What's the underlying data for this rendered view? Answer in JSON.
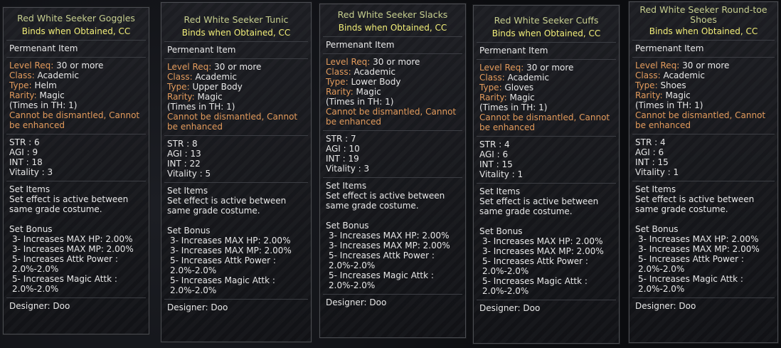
{
  "tooltips": [
    {
      "title": "Red White Seeker Goggles",
      "bind": "Binds when Obtained, CC",
      "item_type": "Permenant Item",
      "level_key": "Level Req:",
      "level_val": "30 or more",
      "class_key": "Class:",
      "class_val": "Academic",
      "type_key": "Type:",
      "type_val": "Helm",
      "rarity_key": "Rarity:",
      "rarity_val": "Magic",
      "times": "(Times in TH: 1)",
      "warning": "Cannot be dismantled, Cannot be enhanced",
      "stats": [
        "STR : 6",
        "AGI : 9",
        "INT : 18",
        "Vitality : 3"
      ],
      "set_items_label": "Set Items",
      "set_effect": "Set effect is active between same grade costume.",
      "set_bonus_label": "Set Bonus",
      "bonuses": [
        "3- Increases MAX HP: 2.00%",
        "3- Increases MAX MP: 2.00%",
        "5- Increases Attk Power : 2.0%-2.0%",
        "5- Increases Magic Attk : 2.0%-2.0%"
      ],
      "designer": "Designer: Doo"
    },
    {
      "title": "Red White Seeker Tunic",
      "bind": "Binds when Obtained, CC",
      "item_type": "Permenant Item",
      "level_key": "Level Req:",
      "level_val": "30 or more",
      "class_key": "Class:",
      "class_val": "Academic",
      "type_key": "Type:",
      "type_val": "Upper Body",
      "rarity_key": "Rarity:",
      "rarity_val": "Magic",
      "times": "(Times in TH: 1)",
      "warning": "Cannot be dismantled, Cannot be enhanced",
      "stats": [
        "STR : 8",
        "AGI : 13",
        "INT : 22",
        "Vitality : 5"
      ],
      "set_items_label": "Set Items",
      "set_effect": "Set effect is active between same grade costume.",
      "set_bonus_label": "Set Bonus",
      "bonuses": [
        "3- Increases MAX HP: 2.00%",
        "3- Increases MAX MP: 2.00%",
        "5- Increases Attk Power : 2.0%-2.0%",
        "5- Increases Magic Attk : 2.0%-2.0%"
      ],
      "designer": "Designer: Doo"
    },
    {
      "title": "Red White Seeker Slacks",
      "bind": "Binds when Obtained, CC",
      "item_type": "Permenant Item",
      "level_key": "Level Req:",
      "level_val": "30 or more",
      "class_key": "Class:",
      "class_val": "Academic",
      "type_key": "Type:",
      "type_val": "Lower Body",
      "rarity_key": "Rarity:",
      "rarity_val": "Magic",
      "times": "(Times in TH: 1)",
      "warning": "Cannot be dismantled, Cannot be enhanced",
      "stats": [
        "STR : 7",
        "AGI : 10",
        "INT : 19",
        "Vitality : 3"
      ],
      "set_items_label": "Set Items",
      "set_effect": "Set effect is active between same grade costume.",
      "set_bonus_label": "Set Bonus",
      "bonuses": [
        "3- Increases MAX HP: 2.00%",
        "3- Increases MAX MP: 2.00%",
        "5- Increases Attk Power : 2.0%-2.0%",
        "5- Increases Magic Attk : 2.0%-2.0%"
      ],
      "designer": "Designer: Doo"
    },
    {
      "title": "Red White Seeker Cuffs",
      "bind": "Binds when Obtained, CC",
      "item_type": "Permenant Item",
      "level_key": "Level Req:",
      "level_val": "30 or more",
      "class_key": "Class:",
      "class_val": "Academic",
      "type_key": "Type:",
      "type_val": "Gloves",
      "rarity_key": "Rarity:",
      "rarity_val": "Magic",
      "times": "(Times in TH: 1)",
      "warning": "Cannot be dismantled, Cannot be enhanced",
      "stats": [
        "STR : 4",
        "AGI : 6",
        "INT : 15",
        "Vitality : 1"
      ],
      "set_items_label": "Set Items",
      "set_effect": "Set effect is active between same grade costume.",
      "set_bonus_label": "Set Bonus",
      "bonuses": [
        "3- Increases MAX HP: 2.00%",
        "3- Increases MAX MP: 2.00%",
        "5- Increases Attk Power : 2.0%-2.0%",
        "5- Increases Magic Attk : 2.0%-2.0%"
      ],
      "designer": "Designer: Doo"
    },
    {
      "title": "Red White Seeker Round-toe Shoes",
      "bind": "Binds when Obtained, CC",
      "item_type": "Permenant Item",
      "level_key": "Level Req:",
      "level_val": "30 or more",
      "class_key": "Class:",
      "class_val": "Academic",
      "type_key": "Type:",
      "type_val": "Shoes",
      "rarity_key": "Rarity:",
      "rarity_val": "Magic",
      "times": "(Times in TH: 1)",
      "warning": "Cannot be dismantled, Cannot be enhanced",
      "stats": [
        "STR : 4",
        "AGI : 6",
        "INT : 15",
        "Vitality : 1"
      ],
      "set_items_label": "Set Items",
      "set_effect": "Set effect is active between same grade costume.",
      "set_bonus_label": "Set Bonus",
      "bonuses": [
        "3- Increases MAX HP: 2.00%",
        "3- Increases MAX MP: 2.00%",
        "5- Increases Attk Power : 2.0%-2.0%",
        "5- Increases Magic Attk : 2.0%-2.0%"
      ],
      "designer": "Designer: Doo"
    }
  ]
}
